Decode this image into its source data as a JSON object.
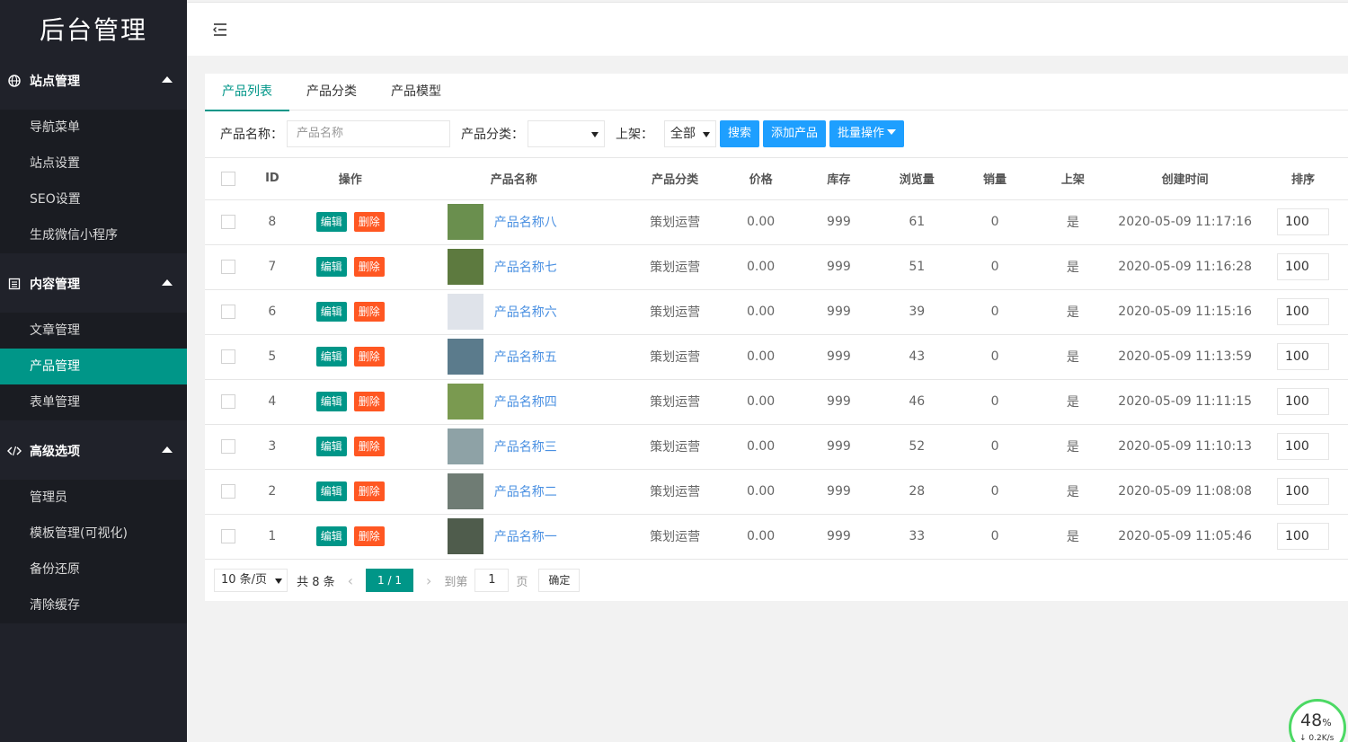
{
  "sidebar": {
    "logo": "后台管理",
    "groups": [
      {
        "title": "站点管理",
        "icon": "globe-icon",
        "items": [
          "导航菜单",
          "站点设置",
          "SEO设置",
          "生成微信小程序"
        ]
      },
      {
        "title": "内容管理",
        "icon": "document-icon",
        "items": [
          "文章管理",
          "产品管理",
          "表单管理"
        ]
      },
      {
        "title": "高级选项",
        "icon": "code-icon",
        "items": [
          "管理员",
          "模板管理(可视化)",
          "备份还原",
          "清除缓存"
        ]
      }
    ],
    "active_item": "产品管理"
  },
  "tabs": [
    "产品列表",
    "产品分类",
    "产品模型"
  ],
  "filters": {
    "name_label": "产品名称：",
    "name_placeholder": "产品名称",
    "category_label": "产品分类：",
    "category_value": "",
    "shelf_label": "上架：",
    "shelf_value": "全部",
    "search_btn": "搜索",
    "add_btn": "添加产品",
    "batch_btn": "批量操作"
  },
  "table": {
    "headers": [
      "ID",
      "操作",
      "产品名称",
      "产品分类",
      "价格",
      "库存",
      "浏览量",
      "销量",
      "上架",
      "创建时间",
      "排序"
    ],
    "edit_label": "编辑",
    "delete_label": "删除",
    "rows": [
      {
        "id": "8",
        "name": "产品名称八",
        "category": "策划运营",
        "price": "0.00",
        "stock": "999",
        "views": "61",
        "sales": "0",
        "shelf": "是",
        "created": "2020-05-09 11:17:16",
        "sort": "100"
      },
      {
        "id": "7",
        "name": "产品名称七",
        "category": "策划运营",
        "price": "0.00",
        "stock": "999",
        "views": "51",
        "sales": "0",
        "shelf": "是",
        "created": "2020-05-09 11:16:28",
        "sort": "100"
      },
      {
        "id": "6",
        "name": "产品名称六",
        "category": "策划运营",
        "price": "0.00",
        "stock": "999",
        "views": "39",
        "sales": "0",
        "shelf": "是",
        "created": "2020-05-09 11:15:16",
        "sort": "100"
      },
      {
        "id": "5",
        "name": "产品名称五",
        "category": "策划运营",
        "price": "0.00",
        "stock": "999",
        "views": "43",
        "sales": "0",
        "shelf": "是",
        "created": "2020-05-09 11:13:59",
        "sort": "100"
      },
      {
        "id": "4",
        "name": "产品名称四",
        "category": "策划运营",
        "price": "0.00",
        "stock": "999",
        "views": "46",
        "sales": "0",
        "shelf": "是",
        "created": "2020-05-09 11:11:15",
        "sort": "100"
      },
      {
        "id": "3",
        "name": "产品名称三",
        "category": "策划运营",
        "price": "0.00",
        "stock": "999",
        "views": "52",
        "sales": "0",
        "shelf": "是",
        "created": "2020-05-09 11:10:13",
        "sort": "100"
      },
      {
        "id": "2",
        "name": "产品名称二",
        "category": "策划运营",
        "price": "0.00",
        "stock": "999",
        "views": "28",
        "sales": "0",
        "shelf": "是",
        "created": "2020-05-09 11:08:08",
        "sort": "100"
      },
      {
        "id": "1",
        "name": "产品名称一",
        "category": "策划运营",
        "price": "0.00",
        "stock": "999",
        "views": "33",
        "sales": "0",
        "shelf": "是",
        "created": "2020-05-09 11:05:46",
        "sort": "100"
      }
    ],
    "thumb_colors": [
      "#6a8f4e",
      "#5d7a3f",
      "#dfe3ea",
      "#5b7b8c",
      "#7a9a50",
      "#8ea2a6",
      "#6f7c74",
      "#4f5c4c"
    ]
  },
  "pagination": {
    "per_page": "10 条/页",
    "total": "共 8 条",
    "current": "1 / 1",
    "goto_label": "到第",
    "goto_value": "1",
    "page_label": "页",
    "confirm": "确定"
  },
  "speed_widget": {
    "percent": "48",
    "percent_unit": "%",
    "rate": "0.2K/s"
  },
  "colors": {
    "primary": "#009688",
    "blue": "#1e9fff",
    "danger": "#ff5722",
    "sidebar_bg": "#20222a"
  }
}
